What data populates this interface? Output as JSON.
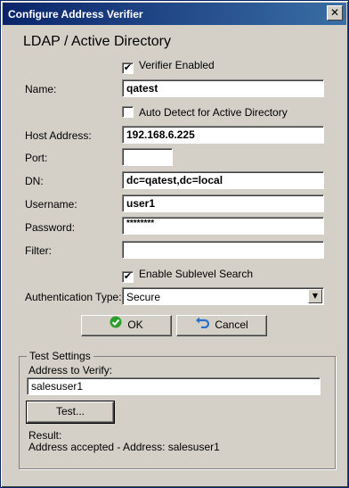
{
  "window": {
    "title": "Configure Address Verifier",
    "close_glyph": "✕"
  },
  "section_title": "LDAP / Active Directory",
  "verifier_enabled": {
    "label": "Verifier Enabled",
    "checked": true
  },
  "name": {
    "label": "Name:",
    "value": "qatest"
  },
  "auto_detect": {
    "label": "Auto Detect for Active Directory",
    "checked": false
  },
  "host_address": {
    "label": "Host Address:",
    "value": "192.168.6.225"
  },
  "port": {
    "label": "Port:",
    "value": ""
  },
  "dn": {
    "label": "DN:",
    "value": "dc=qatest,dc=local"
  },
  "username": {
    "label": "Username:",
    "value": "user1"
  },
  "password": {
    "label": "Password:",
    "value": "********"
  },
  "filter": {
    "label": "Filter:",
    "value": ""
  },
  "sublevel": {
    "label": "Enable Sublevel Search",
    "checked": true
  },
  "auth_type": {
    "label": "Authentication Type:",
    "value": "Secure",
    "arrow": "▼"
  },
  "buttons": {
    "ok": "OK",
    "cancel": "Cancel"
  },
  "test_settings": {
    "legend": "Test Settings",
    "address_label": "Address to Verify:",
    "address_value": "salesuser1",
    "test_button": "Test...",
    "result_label": "Result:",
    "result_text": "Address accepted - Address: salesuser1"
  },
  "icons": {
    "ok": "green-check-icon",
    "cancel": "undo-arrow-icon"
  },
  "colors": {
    "titlebar": "#0a246a",
    "face": "#d4d0c8",
    "ok_icon": "#2e9e2e",
    "cancel_icon": "#2a6fc9"
  }
}
